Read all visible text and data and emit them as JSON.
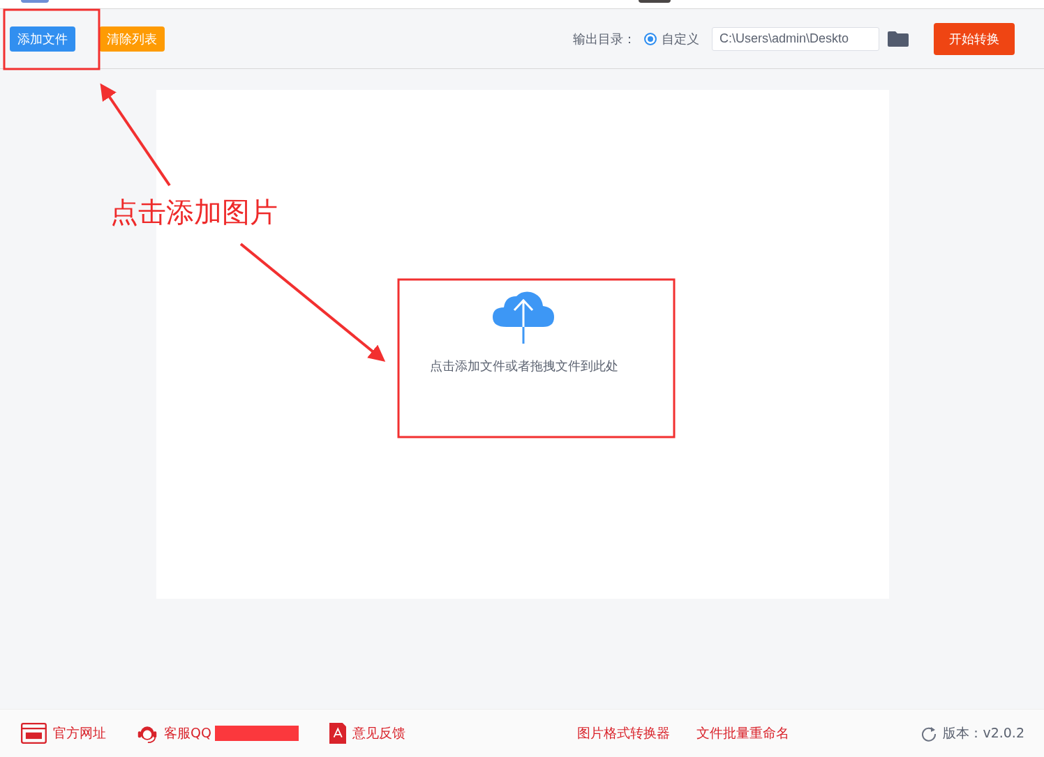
{
  "toolbar": {
    "add_button": "添加文件",
    "clear_button": "清除列表",
    "output_label": "输出目录：",
    "output_mode": {
      "label": "自定义",
      "selected": true
    },
    "output_path": "C:\\Users\\admin\\Deskto",
    "start_button": "开始转换"
  },
  "drop_zone": {
    "hint": "点击添加文件或者拖拽文件到此处"
  },
  "annotation": {
    "text": "点击添加图片"
  },
  "footer": {
    "links": [
      {
        "kind": "web",
        "label": "官方网址"
      },
      {
        "kind": "support",
        "label": "客服QQ"
      },
      {
        "kind": "feedback",
        "label": "意见反馈"
      }
    ],
    "tools": [
      "图片格式转换器",
      "文件批量重命名"
    ],
    "version": "版本：v2.0.2"
  }
}
